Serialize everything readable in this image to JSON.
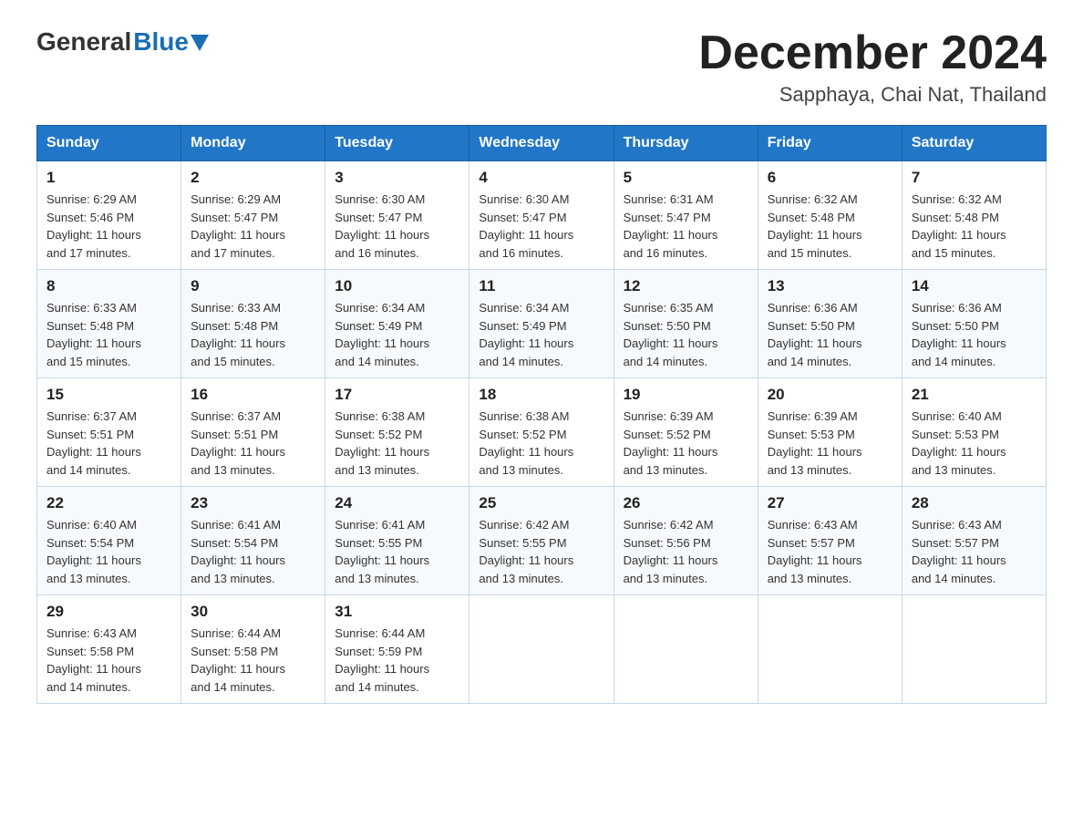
{
  "header": {
    "logo_general": "General",
    "logo_blue": "Blue",
    "month_year": "December 2024",
    "location": "Sapphaya, Chai Nat, Thailand"
  },
  "weekdays": [
    "Sunday",
    "Monday",
    "Tuesday",
    "Wednesday",
    "Thursday",
    "Friday",
    "Saturday"
  ],
  "weeks": [
    [
      {
        "day": "1",
        "sunrise": "6:29 AM",
        "sunset": "5:46 PM",
        "daylight": "11 hours and 17 minutes."
      },
      {
        "day": "2",
        "sunrise": "6:29 AM",
        "sunset": "5:47 PM",
        "daylight": "11 hours and 17 minutes."
      },
      {
        "day": "3",
        "sunrise": "6:30 AM",
        "sunset": "5:47 PM",
        "daylight": "11 hours and 16 minutes."
      },
      {
        "day": "4",
        "sunrise": "6:30 AM",
        "sunset": "5:47 PM",
        "daylight": "11 hours and 16 minutes."
      },
      {
        "day": "5",
        "sunrise": "6:31 AM",
        "sunset": "5:47 PM",
        "daylight": "11 hours and 16 minutes."
      },
      {
        "day": "6",
        "sunrise": "6:32 AM",
        "sunset": "5:48 PM",
        "daylight": "11 hours and 15 minutes."
      },
      {
        "day": "7",
        "sunrise": "6:32 AM",
        "sunset": "5:48 PM",
        "daylight": "11 hours and 15 minutes."
      }
    ],
    [
      {
        "day": "8",
        "sunrise": "6:33 AM",
        "sunset": "5:48 PM",
        "daylight": "11 hours and 15 minutes."
      },
      {
        "day": "9",
        "sunrise": "6:33 AM",
        "sunset": "5:48 PM",
        "daylight": "11 hours and 15 minutes."
      },
      {
        "day": "10",
        "sunrise": "6:34 AM",
        "sunset": "5:49 PM",
        "daylight": "11 hours and 14 minutes."
      },
      {
        "day": "11",
        "sunrise": "6:34 AM",
        "sunset": "5:49 PM",
        "daylight": "11 hours and 14 minutes."
      },
      {
        "day": "12",
        "sunrise": "6:35 AM",
        "sunset": "5:50 PM",
        "daylight": "11 hours and 14 minutes."
      },
      {
        "day": "13",
        "sunrise": "6:36 AM",
        "sunset": "5:50 PM",
        "daylight": "11 hours and 14 minutes."
      },
      {
        "day": "14",
        "sunrise": "6:36 AM",
        "sunset": "5:50 PM",
        "daylight": "11 hours and 14 minutes."
      }
    ],
    [
      {
        "day": "15",
        "sunrise": "6:37 AM",
        "sunset": "5:51 PM",
        "daylight": "11 hours and 14 minutes."
      },
      {
        "day": "16",
        "sunrise": "6:37 AM",
        "sunset": "5:51 PM",
        "daylight": "11 hours and 13 minutes."
      },
      {
        "day": "17",
        "sunrise": "6:38 AM",
        "sunset": "5:52 PM",
        "daylight": "11 hours and 13 minutes."
      },
      {
        "day": "18",
        "sunrise": "6:38 AM",
        "sunset": "5:52 PM",
        "daylight": "11 hours and 13 minutes."
      },
      {
        "day": "19",
        "sunrise": "6:39 AM",
        "sunset": "5:52 PM",
        "daylight": "11 hours and 13 minutes."
      },
      {
        "day": "20",
        "sunrise": "6:39 AM",
        "sunset": "5:53 PM",
        "daylight": "11 hours and 13 minutes."
      },
      {
        "day": "21",
        "sunrise": "6:40 AM",
        "sunset": "5:53 PM",
        "daylight": "11 hours and 13 minutes."
      }
    ],
    [
      {
        "day": "22",
        "sunrise": "6:40 AM",
        "sunset": "5:54 PM",
        "daylight": "11 hours and 13 minutes."
      },
      {
        "day": "23",
        "sunrise": "6:41 AM",
        "sunset": "5:54 PM",
        "daylight": "11 hours and 13 minutes."
      },
      {
        "day": "24",
        "sunrise": "6:41 AM",
        "sunset": "5:55 PM",
        "daylight": "11 hours and 13 minutes."
      },
      {
        "day": "25",
        "sunrise": "6:42 AM",
        "sunset": "5:55 PM",
        "daylight": "11 hours and 13 minutes."
      },
      {
        "day": "26",
        "sunrise": "6:42 AM",
        "sunset": "5:56 PM",
        "daylight": "11 hours and 13 minutes."
      },
      {
        "day": "27",
        "sunrise": "6:43 AM",
        "sunset": "5:57 PM",
        "daylight": "11 hours and 13 minutes."
      },
      {
        "day": "28",
        "sunrise": "6:43 AM",
        "sunset": "5:57 PM",
        "daylight": "11 hours and 14 minutes."
      }
    ],
    [
      {
        "day": "29",
        "sunrise": "6:43 AM",
        "sunset": "5:58 PM",
        "daylight": "11 hours and 14 minutes."
      },
      {
        "day": "30",
        "sunrise": "6:44 AM",
        "sunset": "5:58 PM",
        "daylight": "11 hours and 14 minutes."
      },
      {
        "day": "31",
        "sunrise": "6:44 AM",
        "sunset": "5:59 PM",
        "daylight": "11 hours and 14 minutes."
      },
      null,
      null,
      null,
      null
    ]
  ],
  "labels": {
    "sunrise": "Sunrise:",
    "sunset": "Sunset:",
    "daylight": "Daylight:"
  }
}
